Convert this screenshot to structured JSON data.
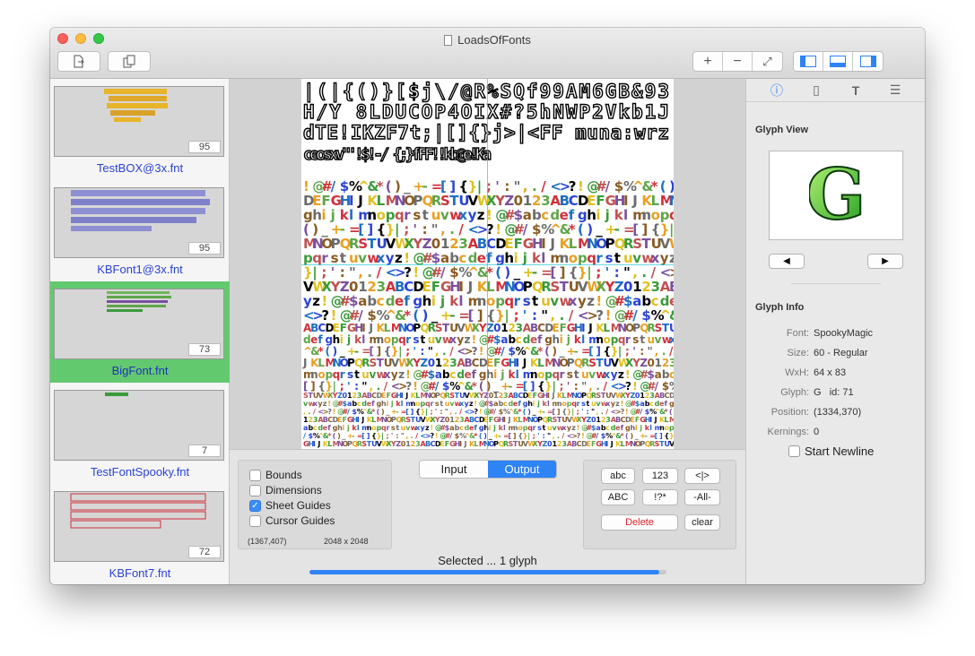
{
  "window": {
    "title": "LoadsOfFonts"
  },
  "toolbar": {
    "new_icon": "new-document-icon",
    "duplicate_icon": "duplicate-icon",
    "zoom_in": "+",
    "zoom_out": "−",
    "zoom_fit": "⤢"
  },
  "sidebar": {
    "items": [
      {
        "label": "TestBOX@3x.fnt",
        "count": "95",
        "color": "#e8b52a"
      },
      {
        "label": "KBFont1@3x.fnt",
        "count": "95",
        "color": "#7f80c9"
      },
      {
        "label": "BigFont.fnt",
        "count": "73",
        "color": "#5fa54a"
      },
      {
        "label": "TestFontSpooky.fnt",
        "count": "7",
        "color": "#3b9b3b"
      },
      {
        "label": "KBFont7.fnt",
        "count": "72",
        "color": "#d0303a"
      }
    ]
  },
  "sheet": {
    "rows": [
      "|(|{()}[$j\\/@R%SQf99AM6GB&93",
      "H/Y 8LDUCOP4OIX#?5hNWP2Vkb1J",
      "dTE!IKZF7t;|[]{}j>|<FF muna:wrz",
      "ceosxv\"'!$!-/ {;}fFF!!kb@e!Ka",
      "!@#/$%^&*()_+-=[]{}|;':\",./<>?",
      "ABCDEFGHIJKLMNOPQRSTUVWXYZ0123",
      "abcdefghijklmnopqrstuvwxyz!@#$"
    ]
  },
  "options": {
    "bounds": "Bounds",
    "dimensions": "Dimensions",
    "sheet_guides": "Sheet Guides",
    "cursor_guides": "Cursor Guides",
    "cursor_pos": "(1367,407)",
    "sheet_size": "2048 x 2048"
  },
  "tabs": {
    "input": "Input",
    "output": "Output"
  },
  "commands": {
    "abc": "abc",
    "n123": "123",
    "bars": "<|>",
    "ABC": "ABC",
    "punct": "!?*",
    "all": "-All-",
    "delete": "Delete",
    "clear": "clear"
  },
  "status": {
    "selected": "Selected ... 1 glyph",
    "progress": 0.98
  },
  "inspector": {
    "tabs": [
      "info-icon",
      "document-icon",
      "text-icon",
      "list-icon"
    ],
    "glyph_view_title": "Glyph View",
    "glyph_char": "G",
    "glyph_info_title": "Glyph Info",
    "font_label": "Font:",
    "font_value": "SpookyMagic",
    "size_label": "Size:",
    "size_value": "60 - Regular",
    "wxh_label": "WxH:",
    "wxh_value": "64 x 83",
    "glyph_label": "Glyph:",
    "glyph_value": "G   id: 71",
    "position_label": "Position:",
    "position_value": "(1334,370)",
    "kernings_label": "Kernings:",
    "kernings_value": "0",
    "start_newline": "Start Newline"
  },
  "colors": {
    "accent": "#2e83f5",
    "selection": "#63c96f",
    "delete": "#e0212a",
    "link": "#2b43d6"
  }
}
